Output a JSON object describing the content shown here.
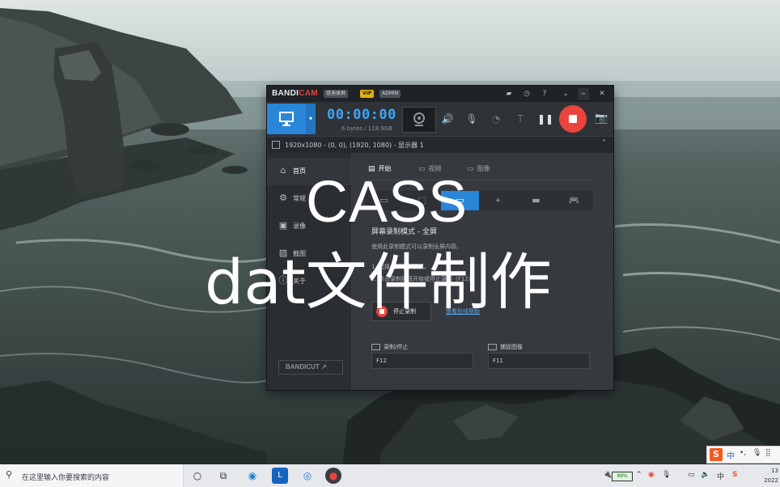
{
  "window": {
    "brand": "BANDICAM",
    "brand_prefix": "BANDI",
    "brand_suffix": "CAM",
    "badge_cn": "班迪录屏",
    "badge_vip": "VIP",
    "badge_admin": "ADMIN",
    "timer": "00:00:00",
    "bytes": "6 bytes / 118.9GB",
    "area_text": "1920x1080 - (0, 0), (1920, 1080) - 显示器 1"
  },
  "sidebar": {
    "items": [
      {
        "label": "首页",
        "icon": "home-icon"
      },
      {
        "label": "常规",
        "icon": "gear-icon"
      },
      {
        "label": "录像",
        "icon": "video-icon"
      },
      {
        "label": "截图",
        "icon": "image-icon"
      },
      {
        "label": "关于",
        "icon": "info-icon"
      }
    ],
    "bandicut_label": "BANDICUT ↗"
  },
  "content": {
    "tabs": [
      {
        "label": "开始",
        "icon": "start-icon"
      },
      {
        "label": "视频",
        "icon": "video-folder-icon"
      },
      {
        "label": "图像",
        "icon": "image-folder-icon"
      }
    ],
    "mode_title": "屏幕录制模式 - 全屏",
    "mode_desc": "使用此录制模式可以录制全屏内容。",
    "step1": "1. 选择全屏录制模式。",
    "step2": "2. 单击录制按钮开始或停止录制（F12）。",
    "stop_label": "停止录制",
    "help_link": "查看在线帮助",
    "hotkey_record_label": "录制/停止",
    "hotkey_record_value": "F12",
    "hotkey_capture_label": "捕捉图像",
    "hotkey_capture_value": "F11"
  },
  "overlay": {
    "line1": "CASS",
    "line2": "dat文件制作"
  },
  "taskbar": {
    "search_placeholder": "在这里输入你要搜索的内容",
    "battery": "99%",
    "clock_top": "13",
    "clock_bottom": "2022"
  },
  "ime": {
    "logo": "S",
    "lang": "中"
  },
  "colors": {
    "accent_blue": "#2a86d8",
    "record_red": "#e9453e",
    "timer_blue": "#39a7ff",
    "vip_gold": "#e3b20b"
  }
}
